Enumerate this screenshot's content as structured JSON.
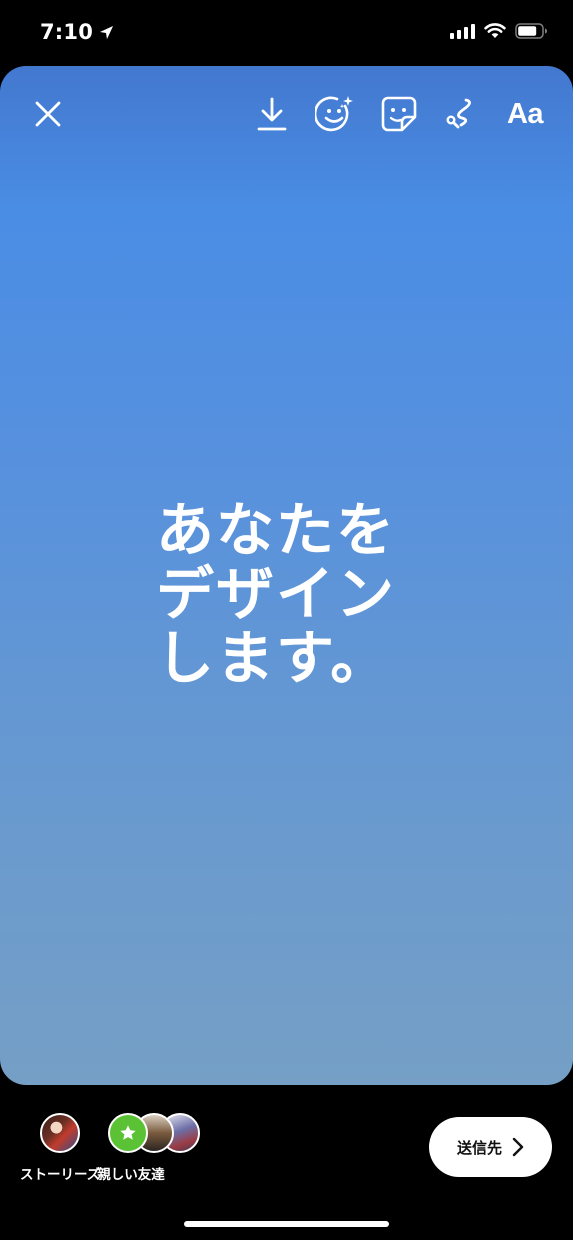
{
  "status": {
    "time": "7:10"
  },
  "toolbar": {
    "close_icon": "close-icon",
    "download_icon": "download-icon",
    "effects_icon": "face-effects-icon",
    "sticker_icon": "sticker-icon",
    "draw_icon": "draw-icon",
    "text_tool_label": "Aa"
  },
  "story": {
    "text": "あなたを\nデザイン\nします。"
  },
  "share": {
    "your_story_label": "ストーリーズ",
    "close_friends_label": "親しい友達",
    "send_label": "送信先"
  },
  "colors": {
    "gradient_top": "#4a8de4",
    "gradient_bottom": "#759fc5",
    "close_friends_green": "#5bc236"
  }
}
